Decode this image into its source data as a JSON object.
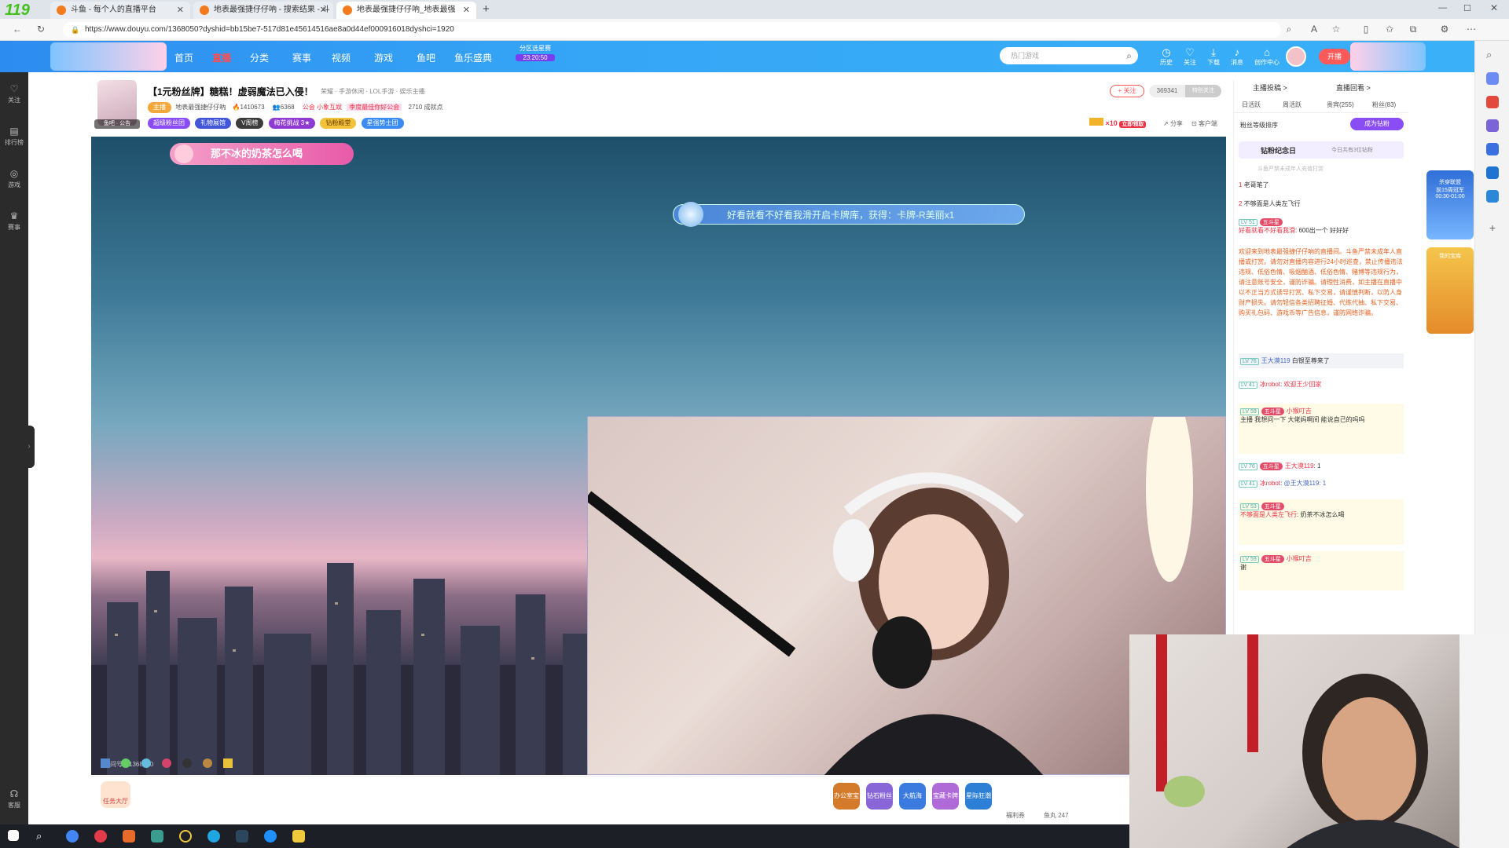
{
  "browser": {
    "tabs": [
      {
        "title": "斗鱼 - 每个人的直播平台"
      },
      {
        "title": "地表最强捷仔仔吶 - 搜索结果 - 斗"
      },
      {
        "title": "地表最强捷仔仔吶_地表最强"
      }
    ],
    "url": "https://www.douyu.com/1368050?dyshid=bb15be7-517d81e45614516ae8a0d44ef000916018dyshci=1920"
  },
  "site_header": {
    "nav": [
      "首页",
      "直播",
      "分类",
      "赛事",
      "视频",
      "游戏",
      "鱼吧",
      "鱼乐盛典"
    ],
    "promo_time": "23:20:50",
    "promo_label": "分区选星赛",
    "search_placeholder": "热门游戏",
    "icons": [
      {
        "label": "历史",
        "icon": "clock-icon"
      },
      {
        "label": "关注",
        "icon": "heart-icon"
      },
      {
        "label": "下载",
        "icon": "download-icon"
      },
      {
        "label": "消息",
        "icon": "bell-icon"
      },
      {
        "label": "创作中心",
        "icon": "location-icon"
      }
    ],
    "open_live": "开播"
  },
  "left_sidebar": [
    {
      "label": "关注",
      "icon": "heart-icon"
    },
    {
      "label": "排行榜",
      "icon": "rank-icon"
    },
    {
      "label": "游戏",
      "icon": "game-icon"
    },
    {
      "label": "赛事",
      "icon": "trophy-icon"
    },
    {
      "label": "客服",
      "icon": "headset-icon"
    }
  ],
  "room": {
    "title": "【1元粉丝牌】糖糕！虚弱魔法已入侵！",
    "category": "荣耀 · 手游休闲 · LOL手游 · 娱乐主播",
    "anchor": "地表最强捷仔仔吶",
    "hot": "1410673",
    "followers": "6368",
    "guild": "公会",
    "guild_name": "小象互娱",
    "tag_join": "季度最佳你好公会",
    "shop_count": "2710 成就点",
    "tags": [
      "超级粉丝团",
      "礼物展馆",
      "V周榜",
      "梅花挑战 3★",
      "钻粉殿堂",
      "星强势士团"
    ],
    "follow_btn": "+ 关注",
    "follow_count": "369341",
    "special_follow": "特别关注",
    "share": "分享",
    "client": "客户端",
    "level_badge": "×10",
    "level_action": "立即领取",
    "avatar_caption": "鱼吧 · 公告"
  },
  "video": {
    "banner_left": "那不冰的奶茶怎么喝",
    "banner_center": "好看就看不好看我滑开启卡牌库，获得：卡牌-R美丽x1",
    "watermark": "房间号：1368050"
  },
  "chat": {
    "tabs_top": [
      "主播投稿 >",
      "直播回看 >"
    ],
    "rank_tabs": [
      "日活跃",
      "周活跃",
      "贵宾(255)",
      "粉丝(83)"
    ],
    "fan_rank_label": "粉丝等级排序",
    "become_fan": "成为钻粉",
    "diamond_title": "钻粉纪念日",
    "diamond_today": "今日共有3位钻粉",
    "diamond_hint": "斗鱼严禁未成年人充值打赏",
    "top_users": [
      {
        "rank": "1",
        "name": "老哥笔了"
      },
      {
        "rank": "2",
        "name": "不够面是人类左飞行"
      }
    ],
    "messages": [
      {
        "level": "LV 51",
        "user": "好看就看不好看我滑",
        "text": "600出一个 好好好"
      },
      {
        "level": "",
        "user": "",
        "text": "欢迎来到地表最强捷仔仔吶的直播间。斗鱼严禁未成年人直播或打赏。请勿对直播内容进行24小时巡查，禁止传播违法违规、低俗色情、吸烟酗酒、低俗色情、赌博等违规行为，请注意账号安全，谨防诈骗。请理性消费，如主播在直播中以不正当方式诱导打赏、私下交易，请谨慎判断，以防人身财产损失。请勿轻信各类招聘征婚、代练代抽、私下交易、购买礼包码、游戏币等广告信息，谨防网络诈骗。"
      },
      {
        "level": "LV 76",
        "user": "王大漠119",
        "text": "白银至尊来了"
      },
      {
        "level": "LV 41",
        "user": "冰robot",
        "text": "欢迎王少回家"
      },
      {
        "level": "LV 59",
        "user": "小猴叮吉",
        "text": "主播 我想问一下 大佬妈啊间 能说自己的吗吗"
      },
      {
        "level": "LV 76",
        "user": "王大漠119",
        "text": "1"
      },
      {
        "level": "LV 41",
        "user": "冰robot",
        "text": "@王大漠119: 1"
      },
      {
        "level": "LV 53",
        "user": "不够面是人类左飞行",
        "text": "奶茶不冰怎么喝"
      },
      {
        "level": "LV 59",
        "user": "小猴叮吉",
        "text": "谢"
      }
    ],
    "medal": "五斗星"
  },
  "right_promo": {
    "item1": "杀穿联盟",
    "item1_sub": "前15周冠军",
    "item1_time": "00:30-01:00",
    "item2": "我的宝库"
  },
  "gift_bar": {
    "task_label": "任务大厅",
    "gifts": [
      "办公室宝箱",
      "钻石粉丝",
      "大航海",
      "宝藏卡牌",
      "星际狂潮"
    ],
    "fish_ball": "鱼丸",
    "fish_ball_count": "247",
    "shark": "福利券"
  },
  "overlay": {
    "logo": "119"
  }
}
